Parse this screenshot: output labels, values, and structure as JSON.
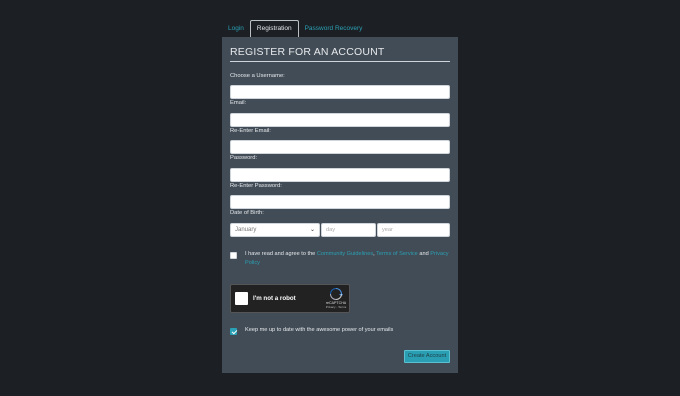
{
  "tabs": [
    {
      "label": "Login"
    },
    {
      "label": "Registration"
    },
    {
      "label": "Password Recovery"
    }
  ],
  "form": {
    "title": "REGISTER FOR AN ACCOUNT",
    "username_label": "Choose a Username:",
    "email_label": "Email:",
    "reemail_label": "Re-Enter Email:",
    "password_label": "Password:",
    "repassword_label": "Re-Enter Password:",
    "dob_label": "Date of Birth:",
    "month_value": "January",
    "day_placeholder": "day",
    "year_placeholder": "year",
    "agree_prefix": "I have read and agree to the ",
    "community_link": "Community Guidelines",
    "sep1": ", ",
    "terms_link": "Terms of Service",
    "and_text": " and ",
    "privacy_link": "Privacy Policy",
    "recaptcha_label": "I'm not a robot",
    "recaptcha_brand": "reCAPTCHA",
    "recaptcha_sub": "Privacy - Terms",
    "keep_label": "Keep me up to date with the awesome power of your emails",
    "create_button": "Create Account",
    "agree_checked": false,
    "keep_checked": true
  },
  "colors": {
    "accent": "#2a9fb3",
    "panel": "#424c56",
    "background": "#1c2025"
  }
}
